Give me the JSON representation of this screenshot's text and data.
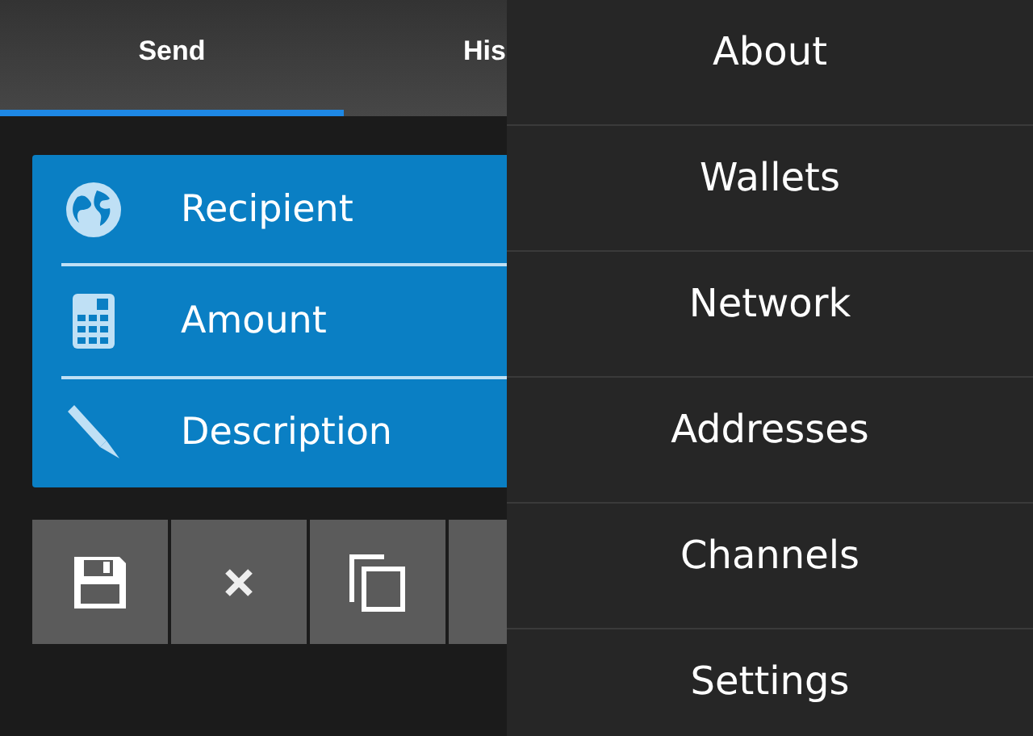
{
  "tabs": [
    {
      "label": "Send",
      "selected": true
    },
    {
      "label": "His",
      "selected": false
    }
  ],
  "form": {
    "fields": [
      {
        "kind": "globe",
        "label": "Recipient"
      },
      {
        "kind": "calculator",
        "label": "Amount"
      },
      {
        "kind": "pen",
        "label": "Description"
      }
    ]
  },
  "buttons": [
    {
      "kind": "save"
    },
    {
      "kind": "clear"
    },
    {
      "kind": "copy"
    },
    {
      "kind": "hidden"
    }
  ],
  "menu": {
    "items": [
      {
        "label": "About"
      },
      {
        "label": "Wallets"
      },
      {
        "label": "Network"
      },
      {
        "label": "Addresses"
      },
      {
        "label": "Channels"
      },
      {
        "label": "Settings"
      }
    ]
  }
}
